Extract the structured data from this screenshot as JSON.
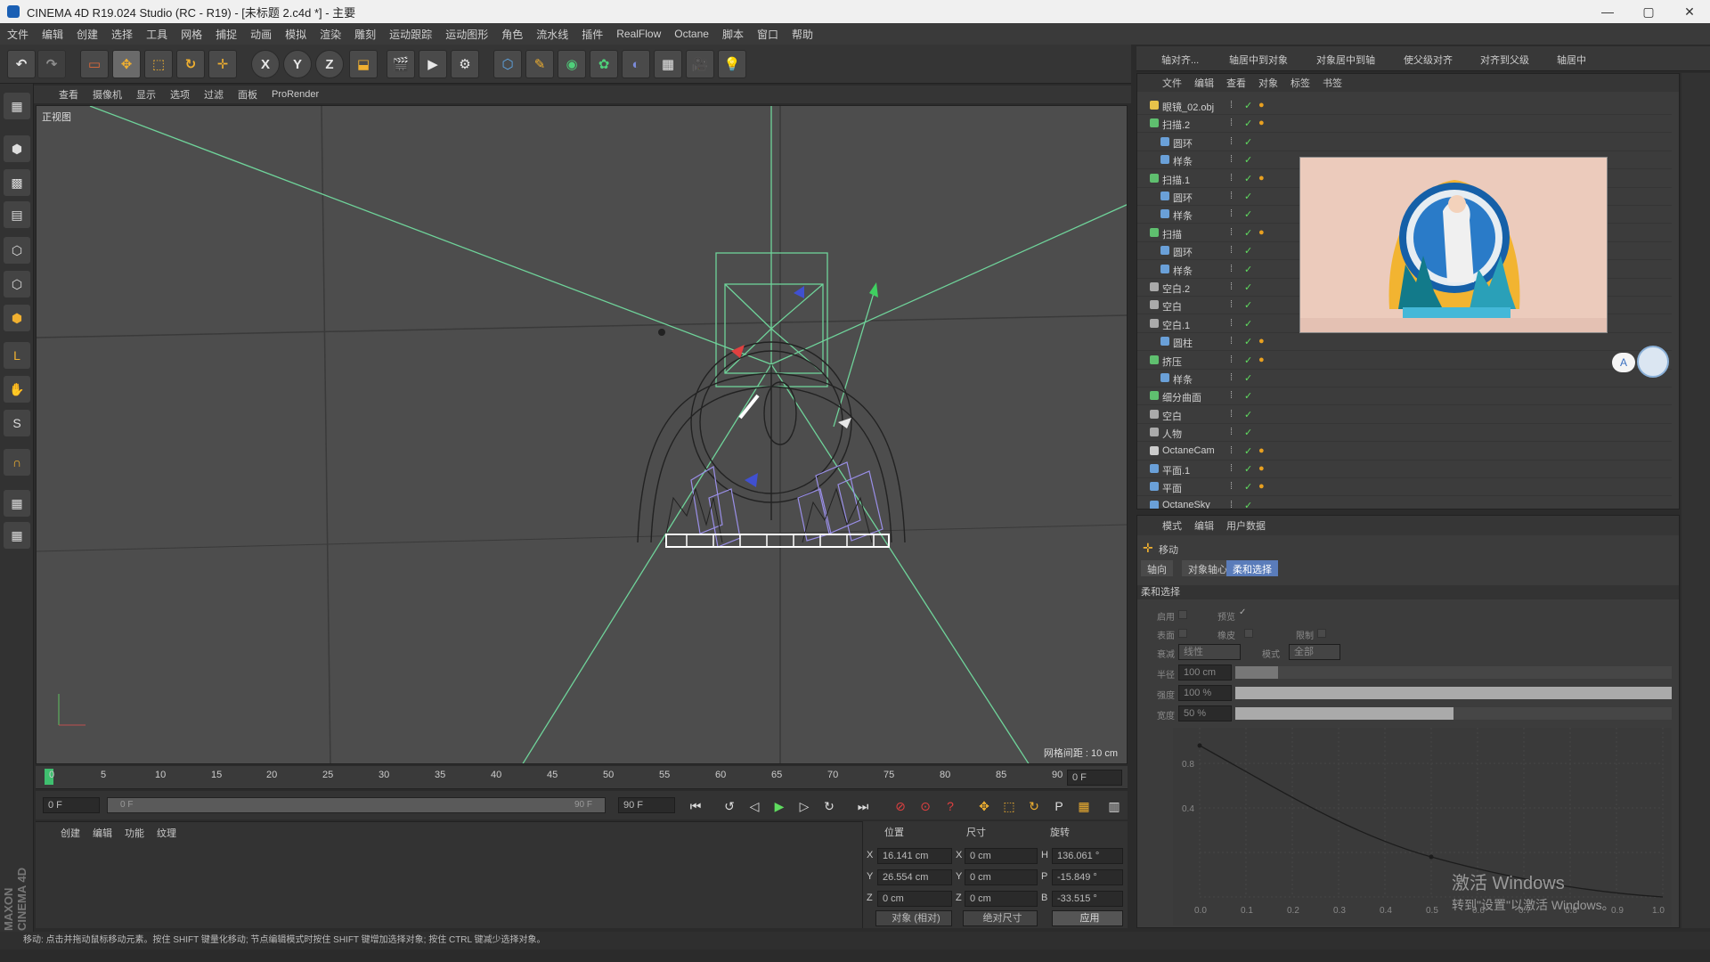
{
  "window": {
    "title": "CINEMA 4D R19.024 Studio (RC - R19) - [未标题 2.c4d *] - 主要",
    "min": "—",
    "max": "▢",
    "close": "✕"
  },
  "menu": [
    "文件",
    "编辑",
    "创建",
    "选择",
    "工具",
    "网格",
    "捕捉",
    "动画",
    "模拟",
    "渲染",
    "雕刻",
    "运动跟踪",
    "运动图形",
    "角色",
    "流水线",
    "插件",
    "RealFlow",
    "Octane",
    "脚本",
    "窗口",
    "帮助"
  ],
  "toolbar": {
    "x_label": "X",
    "y_label": "Y",
    "z_label": "Z"
  },
  "viewport": {
    "menu": [
      "查看",
      "摄像机",
      "显示",
      "选项",
      "过滤",
      "面板",
      "ProRender"
    ],
    "label": "正视图",
    "grid_info": "网格间距 : 10 cm"
  },
  "timeline": {
    "ticks": [
      "0",
      "5",
      "10",
      "15",
      "20",
      "25",
      "30",
      "35",
      "40",
      "45",
      "50",
      "55",
      "60",
      "65",
      "70",
      "75",
      "80",
      "85",
      "90"
    ],
    "frame_right": "0 F",
    "start": "0 F",
    "slider_left": "0 F",
    "slider_right": "90 F",
    "end": "90 F"
  },
  "materials": {
    "menu": [
      "创建",
      "编辑",
      "功能",
      "纹理"
    ]
  },
  "coords": {
    "headers": [
      "位置",
      "尺寸",
      "旋转"
    ],
    "rows": [
      {
        "axis": "X",
        "pos": "16.141 cm",
        "size_axis": "X",
        "size": "0 cm",
        "rot_axis": "H",
        "rot": "136.061 °"
      },
      {
        "axis": "Y",
        "pos": "26.554 cm",
        "size_axis": "Y",
        "size": "0 cm",
        "rot_axis": "P",
        "rot": "-15.849 °"
      },
      {
        "axis": "Z",
        "pos": "0 cm",
        "size_axis": "Z",
        "size": "0 cm",
        "rot_axis": "B",
        "rot": "-33.515 °"
      }
    ],
    "mode_select": "对象 (相对)",
    "size_select": "绝对尺寸",
    "apply": "应用"
  },
  "statusbar": "移动: 点击并拖动鼠标移动元素。按住 SHIFT 键量化移动; 节点编辑模式时按住 SHIFT 键增加选择对象; 按住 CTRL 键减少选择对象。",
  "right_toolbar": [
    "轴对齐...",
    "轴居中到对象",
    "对象居中到轴",
    "使父级对齐",
    "对齐到父级",
    "轴居中"
  ],
  "object_manager": {
    "menu": [
      "文件",
      "编辑",
      "查看",
      "对象",
      "标签",
      "书签"
    ],
    "objects": [
      {
        "name": "眼镜_02.obj",
        "indent": 0,
        "color": "#e8c34a",
        "tag": true
      },
      {
        "name": "扫描.2",
        "indent": 0,
        "color": "#5fbf6f",
        "tag": true
      },
      {
        "name": "圆环",
        "indent": 1,
        "color": "#6aa0d8",
        "tag": false
      },
      {
        "name": "样条",
        "indent": 1,
        "color": "#6aa0d8",
        "tag": false
      },
      {
        "name": "扫描.1",
        "indent": 0,
        "color": "#5fbf6f",
        "tag": true
      },
      {
        "name": "圆环",
        "indent": 1,
        "color": "#6aa0d8",
        "tag": false
      },
      {
        "name": "样条",
        "indent": 1,
        "color": "#6aa0d8",
        "tag": false
      },
      {
        "name": "扫描",
        "indent": 0,
        "color": "#5fbf6f",
        "tag": true
      },
      {
        "name": "圆环",
        "indent": 1,
        "color": "#6aa0d8",
        "tag": false
      },
      {
        "name": "样条",
        "indent": 1,
        "color": "#6aa0d8",
        "tag": false
      },
      {
        "name": "空白.2",
        "indent": 0,
        "color": "#aaaaaa",
        "tag": false
      },
      {
        "name": "空白",
        "indent": 0,
        "color": "#aaaaaa",
        "tag": false
      },
      {
        "name": "空白.1",
        "indent": 0,
        "color": "#aaaaaa",
        "tag": false
      },
      {
        "name": "圆柱",
        "indent": 1,
        "color": "#6aa0d8",
        "tag": true
      },
      {
        "name": "挤压",
        "indent": 0,
        "color": "#5fbf6f",
        "tag": true
      },
      {
        "name": "样条",
        "indent": 1,
        "color": "#6aa0d8",
        "tag": false
      },
      {
        "name": "细分曲面",
        "indent": 0,
        "color": "#5fbf6f",
        "tag": false
      },
      {
        "name": "空白",
        "indent": 0,
        "color": "#aaaaaa",
        "tag": false
      },
      {
        "name": "人物",
        "indent": 0,
        "color": "#aaaaaa",
        "tag": false
      },
      {
        "name": "OctaneCam",
        "indent": 0,
        "color": "#cccccc",
        "tag": true
      },
      {
        "name": "平面.1",
        "indent": 0,
        "color": "#6aa0d8",
        "tag": true
      },
      {
        "name": "平面",
        "indent": 0,
        "color": "#6aa0d8",
        "tag": true
      },
      {
        "name": "OctaneSky",
        "indent": 0,
        "color": "#6aa0d8",
        "tag": false
      }
    ]
  },
  "attributes": {
    "menu": [
      "模式",
      "编辑",
      "用户数据"
    ],
    "title": "移动",
    "tabs": [
      "轴向",
      "对象轴心",
      "柔和选择"
    ],
    "section": "柔和选择",
    "params": {
      "enable": "启用",
      "preview": "预览",
      "surface": "表面",
      "rubber": "橡皮",
      "limit": "限制",
      "falloff_label": "衰减",
      "falloff_value": "线性",
      "mode_label": "模式",
      "mode_value": "全部",
      "radius_label": "半径",
      "radius_value": "100 cm",
      "strength_label": "强度",
      "strength_value": "100 %",
      "width_label": "宽度",
      "width_value": "50 %"
    },
    "graph_y": [
      "0.8",
      "0.4"
    ],
    "graph_x": [
      "0.0",
      "0.1",
      "0.2",
      "0.3",
      "0.4",
      "0.5",
      "0.6",
      "0.7",
      "0.8",
      "0.9",
      "1.0"
    ]
  },
  "watermark": {
    "line1": "激活 Windows",
    "line2": "转到\"设置\"以激活 Windows。"
  },
  "brand": "MAXON CINEMA 4D",
  "colors": {
    "accent": "#5a7cba",
    "camera_lines": "#6fd39a",
    "object_select": "#9a8fe8"
  }
}
